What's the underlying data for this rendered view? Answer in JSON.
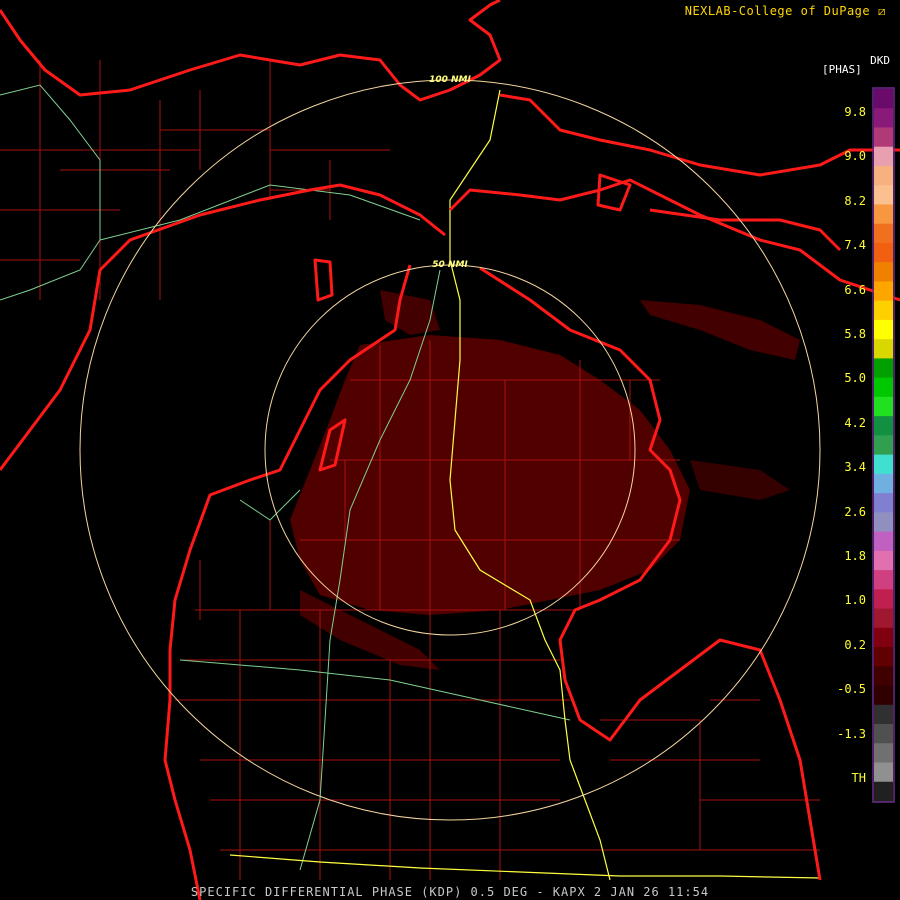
{
  "header": {
    "credit": "NEXLAB-College of DuPage",
    "product_code": "DKD"
  },
  "legend": {
    "unit": "[PHAS]",
    "ticks": [
      "9.8",
      "9.0",
      "8.2",
      "7.4",
      "6.6",
      "5.8",
      "5.0",
      "4.2",
      "3.4",
      "2.6",
      "1.8",
      "1.0",
      "0.2",
      "-0.5",
      "-1.3",
      "TH"
    ],
    "colors": [
      "#6a0a6a",
      "#8a1a7a",
      "#b03a78",
      "#e8a0b0",
      "#f7b080",
      "#fac090",
      "#f79840",
      "#f07020",
      "#f06010",
      "#f08000",
      "#ffa500",
      "#ffd000",
      "#ffff00",
      "#d8d800",
      "#00a000",
      "#00c800",
      "#20e020",
      "#109040",
      "#30a050",
      "#40e0d0",
      "#70b0e0",
      "#8080d0",
      "#9090c0",
      "#c060c0",
      "#e070b0",
      "#d04080",
      "#c02050",
      "#a01830",
      "#800010",
      "#600000",
      "#400000",
      "#300000",
      "#303030",
      "#505050",
      "#707070",
      "#909090",
      "#202020"
    ]
  },
  "range_rings": [
    {
      "label": "100 NMI"
    },
    {
      "label": "50 NMI"
    }
  ],
  "footer": {
    "title": "SPECIFIC DIFFERENTIAL PHASE (KDP) 0.5 DEG - KAPX 2 JAN 26 11:54"
  },
  "colors": {
    "coast": "#ff1a1a",
    "county": "#b01010",
    "highway_yellow": "#ffff40",
    "highway_green": "#80d090",
    "ring": "#f5d5a0",
    "echo": "#5a0000"
  }
}
